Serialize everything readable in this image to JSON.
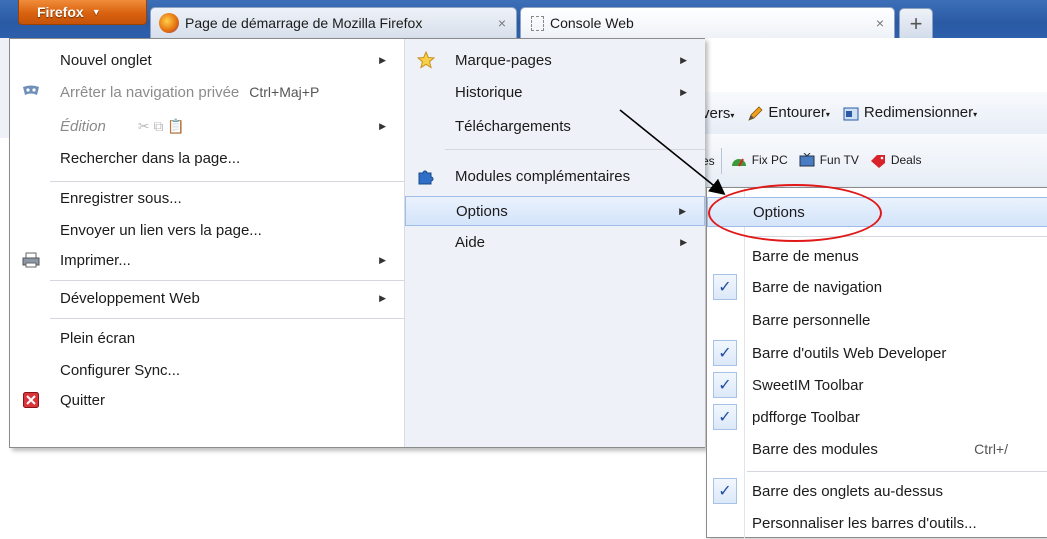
{
  "app": {
    "button_label": "Firefox",
    "tabs": [
      {
        "title": "Page de démarrage de Mozilla Firefox",
        "close": "×"
      },
      {
        "title": "Console Web",
        "close": "×"
      }
    ],
    "new_tab": "+"
  },
  "toolbar": {
    "row1": [
      {
        "label": "vers",
        "icon": ""
      },
      {
        "label": "Entourer",
        "icon": "pencil-icon"
      },
      {
        "label": "Redimensionner",
        "icon": "resize-icon"
      }
    ],
    "row2": [
      {
        "label": "es",
        "icon": ""
      },
      {
        "label": "Fix PC",
        "icon": "gauge-icon"
      },
      {
        "label": "Fun TV",
        "icon": "tv-icon"
      },
      {
        "label": "Deals",
        "icon": "tag-icon"
      }
    ]
  },
  "main_menu": {
    "left": [
      {
        "label": "Nouvel onglet",
        "submenu": true
      },
      {
        "label": "Arrêter la navigation privée",
        "shortcut": "Ctrl+Maj+P",
        "disabled": true,
        "icon": "mask-icon"
      },
      {
        "label": "Édition",
        "submenu": true,
        "disabled": true
      },
      {
        "label": "Rechercher dans la page..."
      },
      {
        "label": "Enregistrer sous..."
      },
      {
        "label": "Envoyer un lien vers la page..."
      },
      {
        "label": "Imprimer...",
        "submenu": true,
        "icon": "printer-icon"
      },
      {
        "label": "Développement Web",
        "submenu": true
      },
      {
        "label": "Plein écran"
      },
      {
        "label": "Configurer Sync..."
      },
      {
        "label": "Quitter",
        "icon": "quit-icon"
      }
    ],
    "right": [
      {
        "label": "Marque-pages",
        "submenu": true,
        "icon": "star-icon"
      },
      {
        "label": "Historique",
        "submenu": true
      },
      {
        "label": "Téléchargements"
      },
      {
        "label": "Modules complémentaires",
        "icon": "puzzle-icon"
      },
      {
        "label": "Options",
        "submenu": true,
        "highlighted": true
      },
      {
        "label": "Aide",
        "submenu": true
      }
    ]
  },
  "options_menu": [
    {
      "label": "Options",
      "highlighted": true
    },
    {
      "label": "Barre de menus",
      "checked": false
    },
    {
      "label": "Barre de navigation",
      "checked": true
    },
    {
      "label": "Barre personnelle",
      "checked": false
    },
    {
      "label": "Barre d'outils Web Developer",
      "checked": true
    },
    {
      "label": "SweetIM Toolbar",
      "checked": true
    },
    {
      "label": "pdfforge Toolbar",
      "checked": true
    },
    {
      "label": "Barre des modules",
      "shortcut": "Ctrl+/",
      "checked": false
    },
    {
      "label": "Barre des onglets au-dessus",
      "checked": true
    },
    {
      "label": "Personnaliser les barres d'outils...",
      "checked": false
    }
  ],
  "colors": {
    "firefox_button": "#d9620f",
    "highlight": "#d4e4fa",
    "annotation": "#e01818",
    "check": "#1f4fa4"
  }
}
